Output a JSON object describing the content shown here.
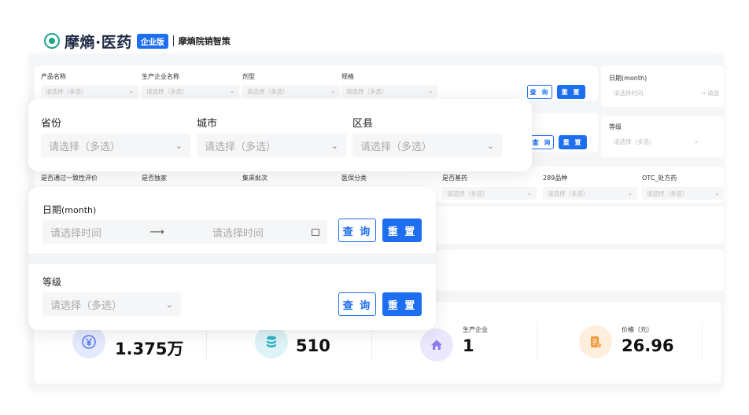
{
  "header": {
    "logo": "摩熵·医药",
    "badge": "企业版",
    "subtitle": "摩熵院销智策"
  },
  "filters": {
    "product_name": "产品名称",
    "manufacturer": "生产企业名称",
    "dosage_form": "剂型",
    "spec": "规格",
    "date_month": "日期(month)",
    "grade": "等级",
    "consistency_eval": "是否通过一致性评价",
    "exclusive": "是否独家",
    "vbp_batch": "集采批次",
    "insurance_class": "医保分类",
    "essential_drug": "是否基药",
    "v289": "289品种",
    "otc_rx": "OTC_处方药",
    "multi_placeholder": "请选择（多选）",
    "time_placeholder": "请选择时间",
    "time_placeholder_cut": "请选"
  },
  "buttons": {
    "query": "查 询",
    "reset": "重 置"
  },
  "region_popup": {
    "province": "省份",
    "city": "城市",
    "county": "区县",
    "placeholder": "请选择（多选）"
  },
  "date_popup": {
    "date_label": "日期",
    "date_label_suffix": "(month)",
    "start_placeholder": "请选择时间",
    "end_placeholder": "请选择时间",
    "grade_label": "等级",
    "grade_placeholder": "请选择（多选）"
  },
  "stats": [
    {
      "label": "",
      "value": "1.375万",
      "icon": "yuan-icon",
      "color": "#5b7cf5",
      "bg": "#e4eafe"
    },
    {
      "label": "",
      "value": "510",
      "icon": "database-icon",
      "color": "#2bb3c7",
      "bg": "#ddf3f7"
    },
    {
      "label": "生产企业",
      "value": "1",
      "icon": "home-icon",
      "color": "#8b7cf0",
      "bg": "#ebe8fd"
    },
    {
      "label": "价格（元）",
      "value": "26.96",
      "icon": "document-icon",
      "color": "#f09a3e",
      "bg": "#fdeedd"
    }
  ]
}
